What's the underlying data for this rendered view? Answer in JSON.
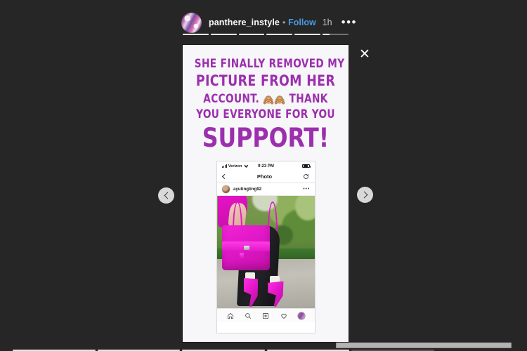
{
  "viewer": {
    "background_color": "#262626",
    "close_label": "✕"
  },
  "story_header": {
    "username": "panthere_instyle",
    "separator": "•",
    "follow_label": "Follow",
    "timestamp": "1h",
    "more_options_label": "•••",
    "avatar_name": "panthere_instyle avatar"
  },
  "progress": {
    "total_segments": 6,
    "current_index": 5,
    "fills": [
      100,
      100,
      100,
      100,
      100,
      28
    ]
  },
  "story_card": {
    "background_color": "#f7f6f8",
    "text_color": "#9b2fae",
    "caption_lines": [
      "SHE FINALLY REMOVED MY",
      "PICTURE FROM HER",
      "ACCOUNT. 🙈🙈 THANK",
      "YOU EVERYONE FOR YOU",
      "SUPPORT!"
    ],
    "caption_line_1": "SHE FINALLY REMOVED MY",
    "caption_line_2": "PICTURE FROM HER",
    "caption_line_3a": "ACCOUNT.",
    "caption_emoji": "🙈🙈",
    "caption_line_3b": "THANK",
    "caption_line_4": "YOU EVERYONE FOR YOU",
    "caption_line_5": "SUPPORT!"
  },
  "inner_phone": {
    "status_bar": {
      "carrier": "Verizon",
      "time": "9:23 PM",
      "signal_icon": "cellular-signal-icon",
      "wifi_icon": "wifi-icon",
      "battery_icon": "battery-icon"
    },
    "nav_bar": {
      "back_icon": "back-chevron-icon",
      "title": "Photo",
      "refresh_icon": "refresh-icon"
    },
    "post_header": {
      "username": "ayutingting92",
      "more_label": "•••",
      "avatar_name": "ayutingting92 avatar"
    },
    "photo": {
      "description": "Woman holding a magenta Birkin handbag wearing magenta high heels on a garden path",
      "bag_color": "#e018c6",
      "heel_color": "#e016c6"
    },
    "tab_bar": {
      "items": [
        {
          "name": "home-icon",
          "label": "Home"
        },
        {
          "name": "search-icon",
          "label": "Search"
        },
        {
          "name": "add-post-icon",
          "label": "Add"
        },
        {
          "name": "heart-icon",
          "label": "Activity"
        },
        {
          "name": "profile-avatar-icon",
          "label": "Profile"
        }
      ]
    }
  },
  "controls": {
    "prev_label": "‹",
    "next_label": "›"
  },
  "bottom_peek": {
    "segments": 5,
    "fills": [
      100,
      100,
      100,
      100,
      0
    ]
  }
}
